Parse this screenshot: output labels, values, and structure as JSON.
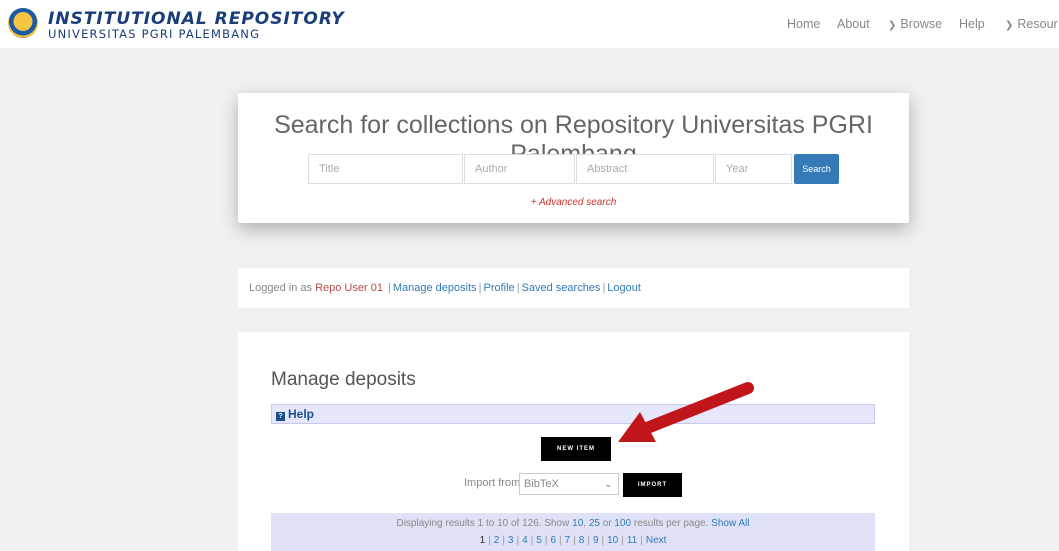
{
  "header": {
    "logo_title": "INSTITUTIONAL REPOSITORY",
    "logo_subtitle": "UNIVERSITAS PGRI PALEMBANG",
    "nav": [
      {
        "label": "Home"
      },
      {
        "label": "About"
      },
      {
        "label": "Browse"
      },
      {
        "label": "Help"
      },
      {
        "label": "Resour"
      }
    ]
  },
  "search": {
    "title": "Search for collections on Repository Universitas PGRI Palembang",
    "title_placeholder": "Title",
    "author_placeholder": "Author",
    "abstract_placeholder": "Abstract",
    "year_placeholder": "Year",
    "button_label": "Search",
    "advanced_label": "+ Advanced search"
  },
  "login": {
    "prefix": "Logged in as",
    "user": "Repo User 01",
    "links": [
      "Manage deposits",
      "Profile",
      "Saved searches",
      "Logout"
    ]
  },
  "manage": {
    "title": "Manage deposits",
    "help_label": "Help",
    "help_icon_glyph": "?",
    "new_item_label": "NEW ITEM",
    "import_label": "Import from",
    "import_selected": "BibTeX",
    "import_button": "IMPORT",
    "results_text_1": "Displaying results 1 to 10 of 126. Show",
    "results_opt_10": "10",
    "results_opt_25": "25",
    "results_or": "or",
    "results_opt_100": "100",
    "results_text_2": "results per page.",
    "results_show_all": "Show All",
    "pages": [
      "1",
      "2",
      "3",
      "4",
      "5",
      "6",
      "7",
      "8",
      "9",
      "10",
      "11"
    ],
    "next_label": "Next"
  },
  "colors": {
    "arrow": "#c0151a",
    "link": "#337ab7",
    "search_button": "#337ab7"
  }
}
